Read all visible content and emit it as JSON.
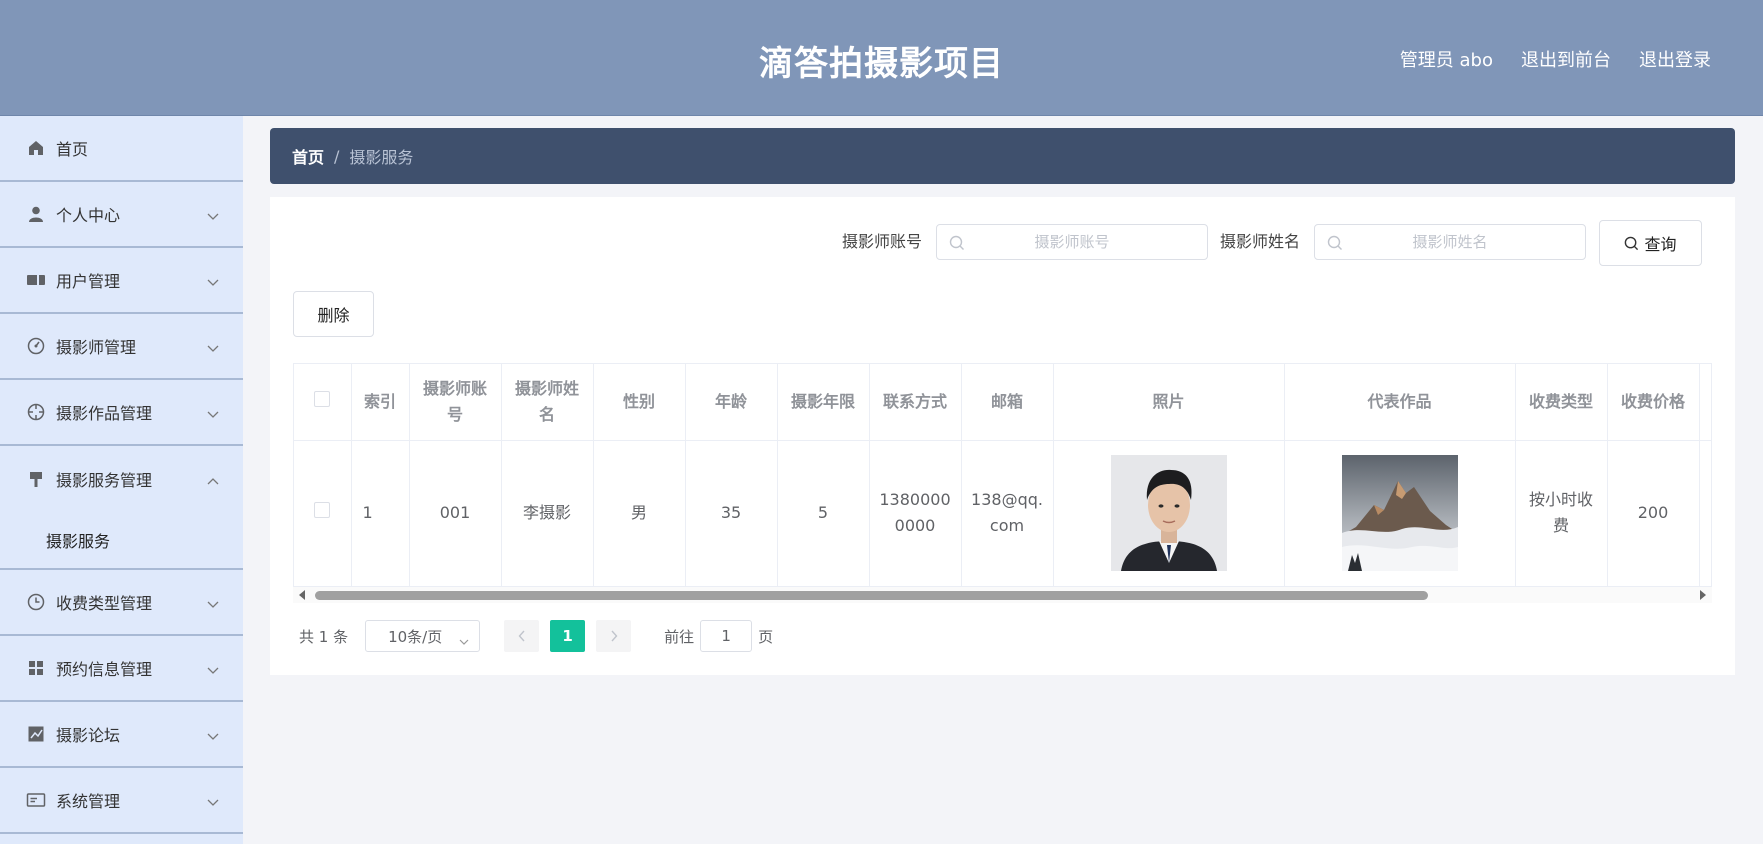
{
  "header": {
    "title": "滴答拍摄影项目",
    "user": "管理员 abo",
    "to_front": "退出到前台",
    "logout": "退出登录"
  },
  "sidebar": {
    "items": [
      {
        "label": "首页",
        "icon": "home-icon"
      },
      {
        "label": "个人中心",
        "icon": "user-icon"
      },
      {
        "label": "用户管理",
        "icon": "ticket-icon"
      },
      {
        "label": "摄影师管理",
        "icon": "dashboard-icon"
      },
      {
        "label": "摄影作品管理",
        "icon": "crosshair-icon"
      },
      {
        "label": "摄影服务管理",
        "icon": "brush-icon",
        "expanded": true
      },
      {
        "label": "收费类型管理",
        "icon": "clock-icon"
      },
      {
        "label": "预约信息管理",
        "icon": "grid-icon"
      },
      {
        "label": "摄影论坛",
        "icon": "chart-icon"
      },
      {
        "label": "系统管理",
        "icon": "card-icon"
      }
    ],
    "sub_item": "摄影服务"
  },
  "breadcrumb": {
    "home": "首页",
    "separator": "/",
    "current": "摄影服务"
  },
  "search": {
    "account_label": "摄影师账号",
    "account_placeholder": "摄影师账号",
    "name_label": "摄影师姓名",
    "name_placeholder": "摄影师姓名",
    "query_button": "查询"
  },
  "actions": {
    "delete_button": "删除"
  },
  "table": {
    "columns": [
      "索引",
      "摄影师账号",
      "摄影师姓名",
      "性别",
      "年龄",
      "摄影年限",
      "联系方式",
      "邮箱",
      "照片",
      "代表作品",
      "收费类型",
      "收费价格"
    ],
    "rows": [
      {
        "index": "1",
        "account": "001",
        "name": "李摄影",
        "gender": "男",
        "age": "35",
        "years": "5",
        "phone": "13800000000",
        "email": "138@qq.com",
        "photo": "portrait-photo",
        "work": "mountain-photo",
        "fee_type": "按小时收费",
        "price": "200"
      }
    ]
  },
  "pagination": {
    "total": "共 1 条",
    "page_size": "10条/页",
    "current_page": "1",
    "goto_label": "前往",
    "goto_value": "1",
    "page_unit": "页"
  },
  "colors": {
    "header_bg": "#8096b8",
    "sidebar_bg": "#dfe9fb",
    "breadcrumb_bg": "#3f506d",
    "accent": "#13c19b"
  }
}
